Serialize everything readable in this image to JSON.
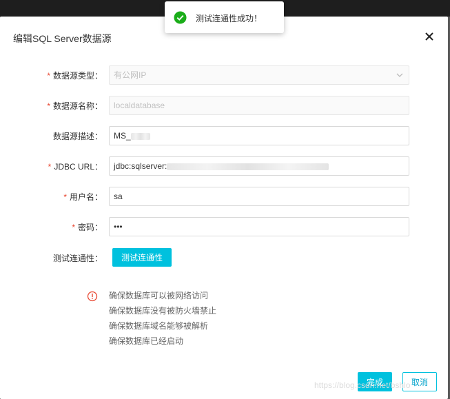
{
  "colors": {
    "accent": "#00c1de",
    "required": "#e8452f",
    "success": "#1aad19",
    "warning": "#e8452f"
  },
  "dialog": {
    "title": "编辑SQL Server数据源",
    "close_icon": "close-icon"
  },
  "toast": {
    "message": "测试连通性成功！",
    "icon": "check-circle-icon"
  },
  "form": {
    "source_type": {
      "label": "数据源类型：",
      "required": "*",
      "value": "有公网IP",
      "icon": "chevron-down-icon"
    },
    "source_name": {
      "label": "数据源名称：",
      "required": "*",
      "value": "localdatabase"
    },
    "description": {
      "label": "数据源描述：",
      "value": "MS_"
    },
    "jdbc_url": {
      "label": "JDBC URL：",
      "required": "*",
      "value": "jdbc:sqlserver:"
    },
    "username": {
      "label": "用户名：",
      "required": "*",
      "value": "sa"
    },
    "password": {
      "label": "密码：",
      "required": "*",
      "value": "•••"
    },
    "test": {
      "label": "测试连通性：",
      "button": "测试连通性"
    }
  },
  "tips": {
    "icon": "info-circle-icon",
    "items": [
      "确保数据库可以被网络访问",
      "确保数据库没有被防火墙禁止",
      "确保数据库域名能够被解析",
      "确保数据库已经启动"
    ]
  },
  "footer": {
    "done": "完成",
    "cancel": "取消"
  },
  "watermark": "https://blog.csdn.net/bshlo"
}
